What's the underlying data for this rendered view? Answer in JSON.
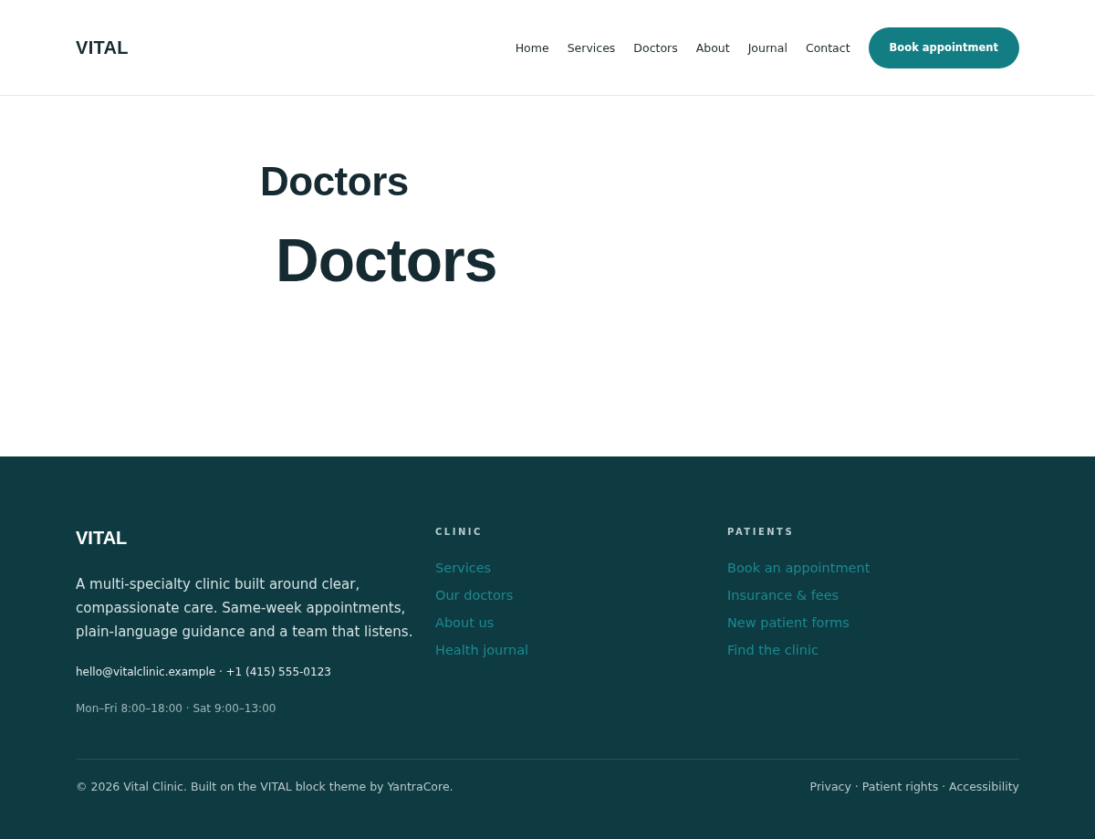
{
  "header": {
    "logo": "VITAL",
    "nav": [
      "Home",
      "Services",
      "Doctors",
      "About",
      "Journal",
      "Contact"
    ],
    "cta": "Book appointment"
  },
  "main": {
    "page_title": "Doctors",
    "heading": "Doctors"
  },
  "footer": {
    "logo": "VITAL",
    "description": "A multi-specialty clinic built around clear, compassionate care. Same-week appointments, plain-language guidance and a team that listens.",
    "contact": "hello@vitalclinic.example · +1 (415) 555-0123",
    "hours": "Mon–Fri 8:00–18:00 · Sat 9:00–13:00",
    "columns": [
      {
        "title": "CLINIC",
        "links": [
          "Services",
          "Our doctors",
          "About us",
          "Health journal"
        ]
      },
      {
        "title": "PATIENTS",
        "links": [
          "Book an appointment",
          "Insurance & fees",
          "New patient forms",
          "Find the clinic"
        ]
      }
    ],
    "copyright": "© 2026 Vital Clinic. Built on the VITAL block theme by YantraCore.",
    "legal": "Privacy · Patient rights · Accessibility"
  }
}
